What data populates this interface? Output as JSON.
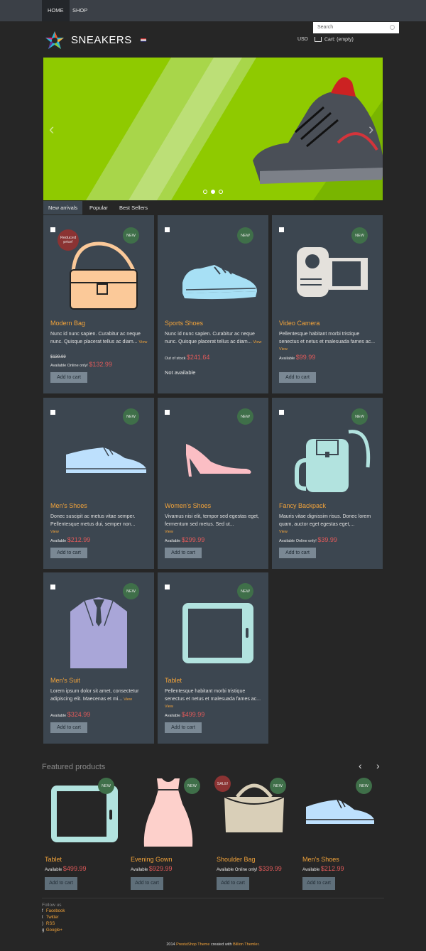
{
  "nav": {
    "home": "HOME",
    "shop": "SHOP"
  },
  "header": {
    "search_placeholder": "Search",
    "brand": "SNEAKERS",
    "currency": "USD",
    "cart": "Cart: (empty)"
  },
  "slider": {
    "prev": "‹",
    "next": "›"
  },
  "tabs": [
    "New arrivals",
    "Popular",
    "Best Sellers"
  ],
  "products": [
    {
      "name": "Modern Bag",
      "desc": "Nunc id nunc sapien. Curabitur ac neque nunc. Quisque placerat tellus ac diam...",
      "view": "View",
      "old_price": "$139.99",
      "availability": "Available Online only!",
      "price": "$132.99",
      "badge": "NEW",
      "reduced": "Reduced price!",
      "button": "Add to cart"
    },
    {
      "name": "Sports Shoes",
      "desc": "Nunc id nunc sapien. Curabitur ac neque nunc. Quisque placerat tellus ac diam...",
      "view": "View",
      "availability": "Out of stock",
      "price": "$241.64",
      "badge": "NEW",
      "not_available": "Not available"
    },
    {
      "name": "Video Camera",
      "desc": "Pellentesque habitant morbi tristique senectus et netus et malesuada fames ac...",
      "view": "View",
      "availability": "Available",
      "price": "$99.99",
      "badge": "NEW",
      "button": "Add to cart"
    },
    {
      "name": "Men's Shoes",
      "desc": "Donec suscipit ac metus vitae semper. Pellentesque metus dui, semper non...",
      "view": "View",
      "availability": "Available",
      "price": "$212.99",
      "badge": "NEW",
      "button": "Add to cart"
    },
    {
      "name": "Women's Shoes",
      "desc": "Vivamus nisi elit, tempor sed egestas eget, fermentum sed metus. Sed ut...",
      "view": "View",
      "availability": "Available",
      "price": "$299.99",
      "badge": "NEW",
      "button": "Add to cart"
    },
    {
      "name": "Fancy Backpack",
      "desc": "Mauris vitae dignissim risus. Donec lorem quam, auctor eget egestas eget,...",
      "view": "View",
      "availability": "Available Online only!",
      "price": "$39.99",
      "badge": "NEW",
      "button": "Add to cart"
    },
    {
      "name": "Men's Suit",
      "desc": "Lorem ipsum dolor sit amet, consectetur adipiscing elit. Maecenas et mi...",
      "view": "View",
      "availability": "Available",
      "price": "$324.99",
      "badge": "NEW",
      "button": "Add to cart"
    },
    {
      "name": "Tablet",
      "desc": "Pellentesque habitant morbi tristique senectus et netus et malesuada fames ac...",
      "view": "View",
      "availability": "Available",
      "price": "$499.99",
      "badge": "NEW",
      "button": "Add to cart"
    }
  ],
  "featured": {
    "title": "Featured products",
    "prev": "‹",
    "next": "›",
    "items": [
      {
        "name": "Tablet",
        "availability": "Available",
        "price": "$499.99",
        "badge": "NEW",
        "button": "Add to cart"
      },
      {
        "name": "Evening Gown",
        "availability": "Available",
        "price": "$929.99",
        "badge": "NEW",
        "button": "Add to cart"
      },
      {
        "name": "Shoulder Bag",
        "availability": "Available Online only!",
        "price": "$339.99",
        "badge": "NEW",
        "sale": "SALE!",
        "button": "Add to cart"
      },
      {
        "name": "Men's Shoes",
        "availability": "Available",
        "price": "$212.99",
        "badge": "NEW",
        "button": "Add to cart"
      }
    ]
  },
  "footer": {
    "follow": "Follow us",
    "social": [
      "Facebook",
      "Twitter",
      "RSS",
      "Google+"
    ],
    "copy_year": "2014",
    "copy_theme": "PrestaShop Theme",
    "copy_mid": "created with",
    "copy_maker": "Billion Themler",
    "copy_end": "."
  },
  "colors": {
    "accent": "#f2a33a",
    "price": "#e05a5a",
    "card": "#3c4650",
    "new_badge": "#3f6f49",
    "slide": "#8fca00"
  }
}
